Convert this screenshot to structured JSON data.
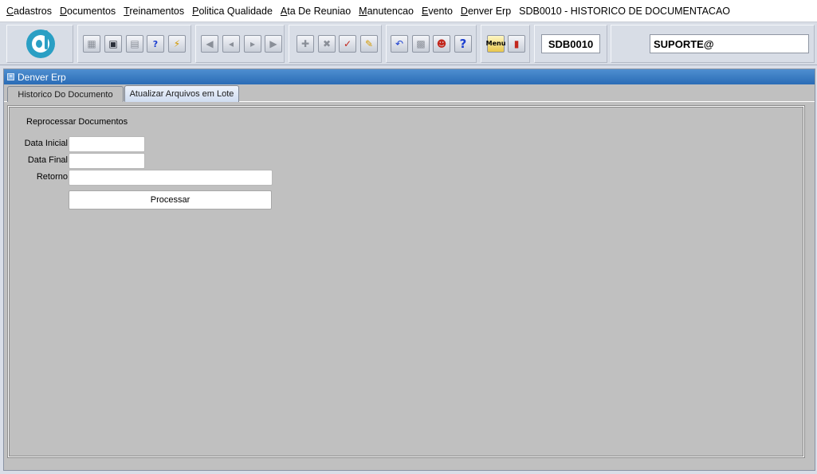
{
  "menu": {
    "items": [
      {
        "accel": "C",
        "rest": "adastros"
      },
      {
        "accel": "D",
        "rest": "ocumentos"
      },
      {
        "accel": "T",
        "rest": "reinamentos"
      },
      {
        "accel": "P",
        "rest": "olitica Qualidade"
      },
      {
        "accel": "A",
        "rest": "ta De Reuniao"
      },
      {
        "accel": "M",
        "rest": "anutencao"
      },
      {
        "accel": "E",
        "rest": "vento"
      },
      {
        "accel": "D",
        "rest": "enver Erp"
      }
    ],
    "screen_title": "SDB0010 - HISTORICO DE DOCUMENTACAO"
  },
  "toolbar": {
    "program_code": "SDB0010",
    "user": "SUPORTE@",
    "menu_icon_text": "Menu",
    "help_glyph": "?"
  },
  "window": {
    "title": "Denver Erp",
    "tabs": [
      {
        "label": "Historico Do Documento",
        "active": false
      },
      {
        "label": "Atualizar Arquivos em Lote",
        "active": true
      }
    ]
  },
  "form": {
    "section_title": "Reprocessar Documentos",
    "data_inicial_label": "Data Inicial",
    "data_inicial_value": "",
    "data_final_label": "Data Final",
    "data_final_value": "",
    "retorno_label": "Retorno",
    "retorno_value": "",
    "process_button": "Processar"
  },
  "colors": {
    "title_bar": "#2a6cb6",
    "logo": "#2a9fc4",
    "canvas": "#c0c0c0"
  }
}
